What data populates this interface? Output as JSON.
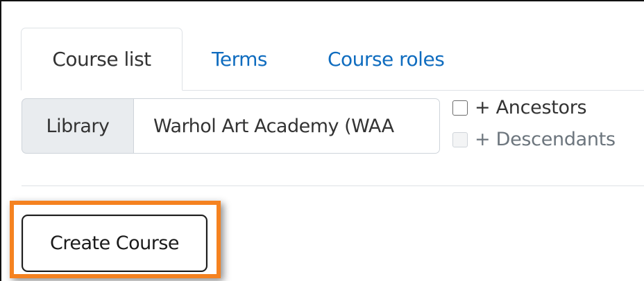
{
  "tabs": [
    {
      "label": "Course list",
      "active": true
    },
    {
      "label": "Terms",
      "active": false
    },
    {
      "label": "Course roles",
      "active": false
    }
  ],
  "filter": {
    "addon_label": "Library",
    "selected_value": "Warhol Art Academy (WAA"
  },
  "checkboxes": {
    "ancestors": {
      "label": "+ Ancestors",
      "checked": false,
      "disabled": false
    },
    "descendants": {
      "label": "+ Descendants",
      "checked": false,
      "disabled": true
    }
  },
  "actions": {
    "create_course_label": "Create Course"
  },
  "colors": {
    "link": "#0f6cbf",
    "highlight": "#f58220",
    "addon_bg": "#e9ecef"
  }
}
